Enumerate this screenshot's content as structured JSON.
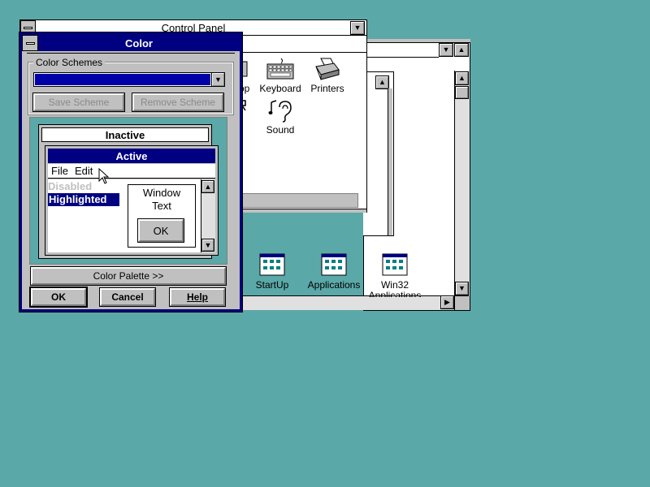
{
  "control_panel": {
    "title": "Control Panel",
    "icons": [
      {
        "label": "op",
        "icon": "desktop-icon"
      },
      {
        "label": "Keyboard",
        "icon": "keyboard-icon"
      },
      {
        "label": "Printers",
        "icon": "printer-icon"
      },
      {
        "label": "Sound",
        "icon": "sound-icon"
      }
    ]
  },
  "program_manager": {
    "groups": [
      {
        "label": "StartUp",
        "icon": "program-group-icon"
      },
      {
        "label": "Applications",
        "icon": "program-group-icon"
      },
      {
        "label": "Win32",
        "label2": "Applications",
        "icon": "program-group-icon"
      }
    ]
  },
  "color_dialog": {
    "title": "Color",
    "schemes_label": "Color Schemes",
    "save_scheme": "Save Scheme",
    "remove_scheme": "Remove Scheme",
    "preview": {
      "inactive_title": "Inactive",
      "active_title": "Active",
      "menu_file": "File",
      "menu_edit": "Edit",
      "disabled_text": "Disabled",
      "highlighted_text": "Highlighted",
      "window_text_1": "Window",
      "window_text_2": "Text",
      "ok": "OK"
    },
    "color_palette": "Color Palette >>",
    "ok": "OK",
    "cancel": "Cancel",
    "help": "Help"
  },
  "colors": {
    "desktop": "#5ba8a8",
    "active_title": "#000080",
    "highlight": "#000080",
    "face": "#c0c0c0"
  }
}
